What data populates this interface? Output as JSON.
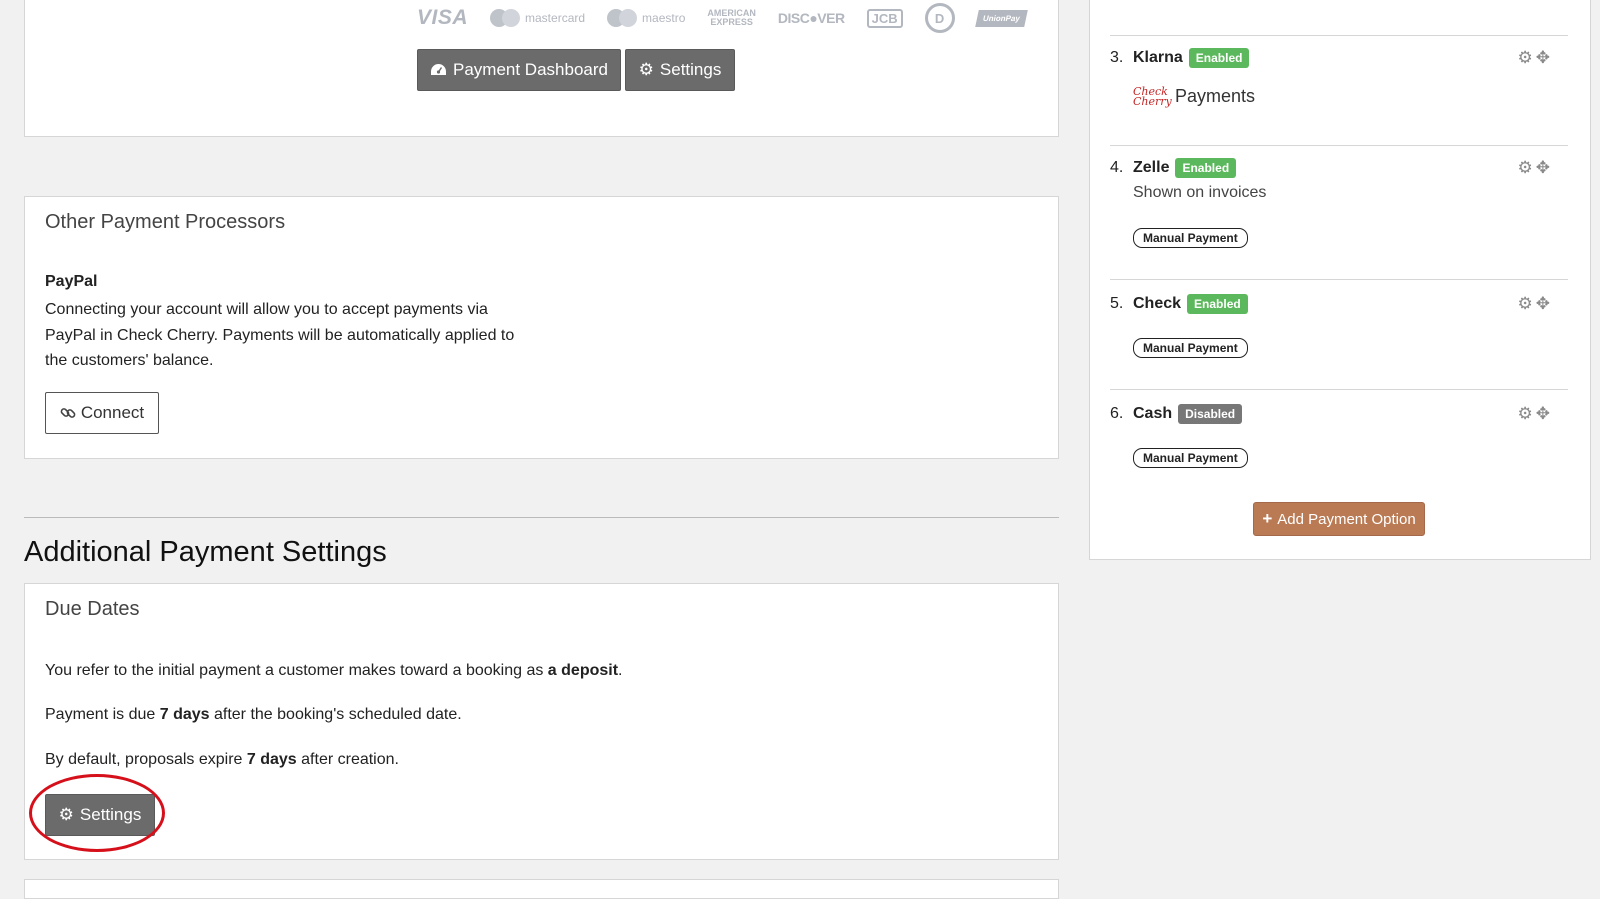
{
  "card_logos": {
    "visa": "VISA",
    "mastercard": "mastercard",
    "maestro": "maestro",
    "amex_line1": "AMERICAN",
    "amex_line2": "EXPRESS",
    "discover": "DISC●VER",
    "jcb": "JCB",
    "diners": "D",
    "unionpay": "UnionPay"
  },
  "top": {
    "dashboard_label": "Payment Dashboard",
    "settings_label": "Settings"
  },
  "other_processors": {
    "title": "Other Payment Processors",
    "paypal": {
      "name": "PayPal",
      "description": "Connecting your account will allow you to accept payments via PayPal in Check Cherry. Payments will be automatically applied to the customers' balance.",
      "connect_label": "Connect"
    }
  },
  "additional": {
    "section_title": "Additional Payment Settings",
    "due_dates": {
      "title": "Due Dates",
      "line1_prefix": "You refer to the initial payment a customer makes toward a booking as ",
      "line1_bold": "a deposit",
      "line1_suffix": ".",
      "line2_prefix": "Payment is due ",
      "line2_bold": "7 days",
      "line2_suffix": " after the booking's scheduled date.",
      "line3_prefix": "By default, proposals expire ",
      "line3_bold": "7 days",
      "line3_suffix": " after creation.",
      "settings_label": "Settings"
    }
  },
  "payment_options": [
    {
      "number": "3.",
      "name": "Klarna",
      "status": "Enabled",
      "logo_mark": "Check Cherry",
      "logo_text": "Payments"
    },
    {
      "number": "4.",
      "name": "Zelle",
      "status": "Enabled",
      "subtitle": "Shown on invoices",
      "tag": "Manual Payment"
    },
    {
      "number": "5.",
      "name": "Check",
      "status": "Enabled",
      "tag": "Manual Payment"
    },
    {
      "number": "6.",
      "name": "Cash",
      "status": "Disabled",
      "tag": "Manual Payment"
    }
  ],
  "add_option_label": "Add Payment Option",
  "colors": {
    "enabled": "#5cb85c",
    "disabled": "#777777",
    "button_dark": "#6b6b6b",
    "accent_brown": "#b97a54",
    "highlight_red": "#d6101a"
  }
}
